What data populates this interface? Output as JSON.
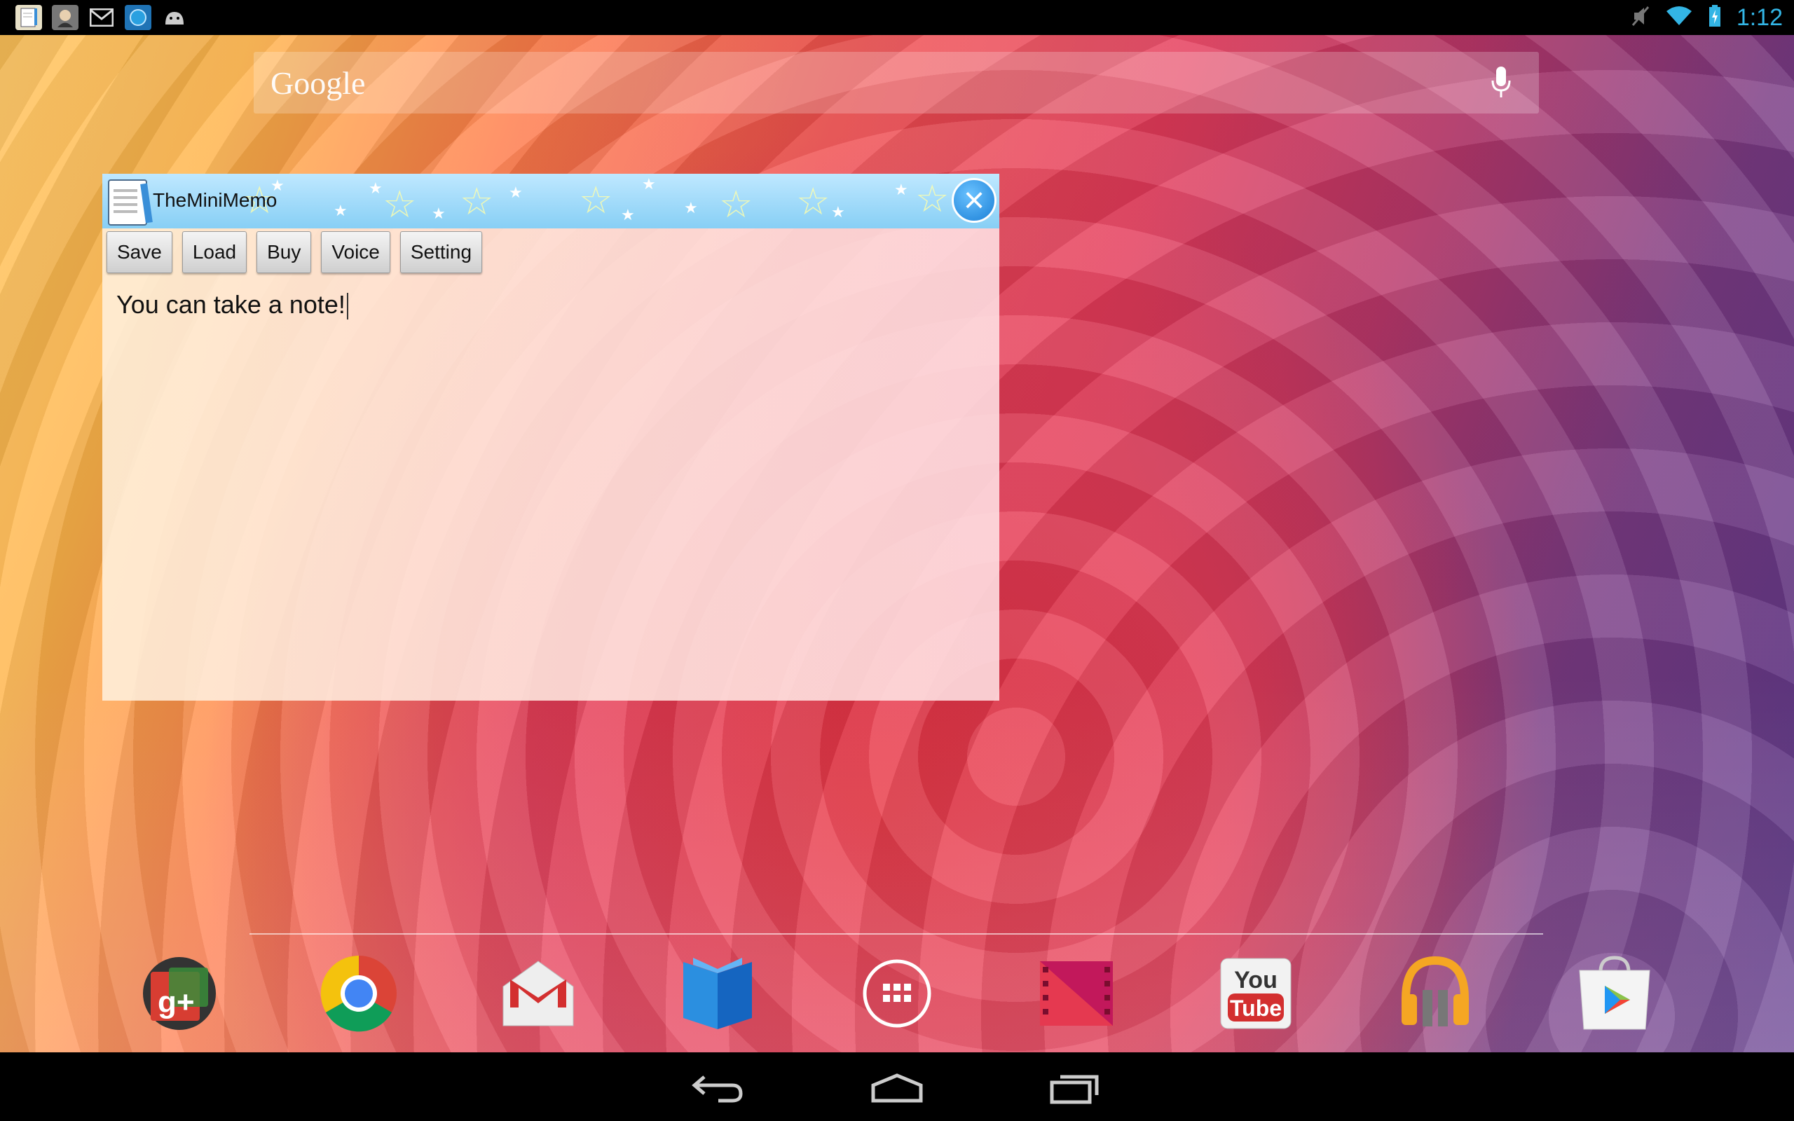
{
  "status_bar": {
    "time": "1:12",
    "notifications": [
      "memo-app-icon",
      "avatar-icon",
      "gmail-icon",
      "blue-app-icon",
      "android-icon"
    ],
    "system_icons": [
      "mute-icon",
      "wifi-icon",
      "battery-icon"
    ]
  },
  "search": {
    "logo": "Google"
  },
  "memo": {
    "title": "TheMiniMemo",
    "buttons": {
      "save": "Save",
      "load": "Load",
      "buy": "Buy",
      "voice": "Voice",
      "setting": "Setting"
    },
    "note_text": "You can take a note!"
  },
  "dock": {
    "apps": [
      "google-plus",
      "chrome",
      "gmail",
      "play-books",
      "all-apps",
      "play-movies",
      "youtube",
      "play-music",
      "play-store"
    ],
    "youtube_label_top": "You",
    "youtube_label_bottom": "Tube"
  },
  "colors": {
    "status_accent": "#33b5e5",
    "titlebar": "#87cff5"
  }
}
